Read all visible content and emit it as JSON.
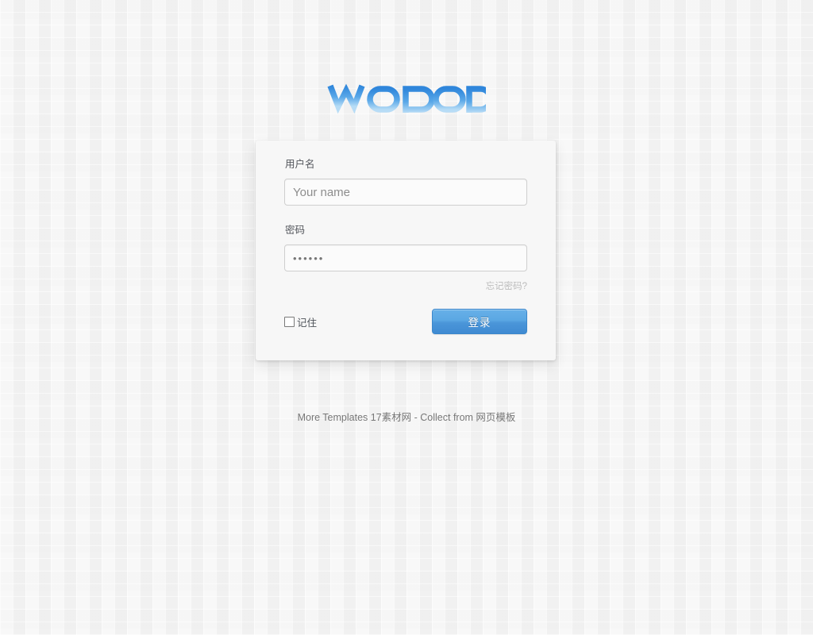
{
  "brand": {
    "logo_text": "wopop",
    "logo_color_top": "#2f86db",
    "logo_color_bottom": "#8fc4ef"
  },
  "form": {
    "username_label": "用户名",
    "username_placeholder": "Your name",
    "username_value": "",
    "password_label": "密码",
    "password_value": "••••••",
    "forgot_link": "忘记密码?",
    "remember_label": "记住",
    "remember_checked": false,
    "submit_label": "登录",
    "submit_color": "#4b96d9"
  },
  "footer": {
    "text": "More Templates 17素材网 - Collect from 网页模板"
  }
}
